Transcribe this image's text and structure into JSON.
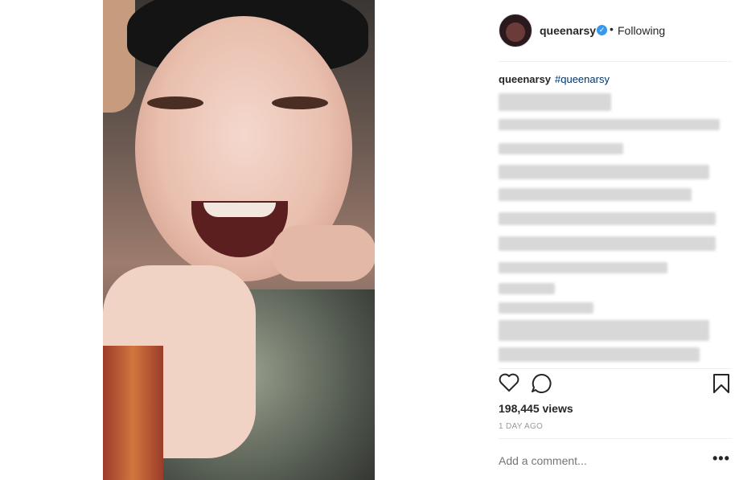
{
  "header": {
    "username": "queenarsy",
    "verified_icon": "verified-badge-icon",
    "separator": "•",
    "follow_status": "Following"
  },
  "caption": {
    "username": "queenarsy",
    "hashtag": "#queenarsy"
  },
  "stats": {
    "views": "198,445 views",
    "time_ago": "1 DAY AGO"
  },
  "comment": {
    "placeholder": "Add a comment..."
  },
  "more_label": "•••",
  "colors": {
    "accent": "#3897f0",
    "hashtag": "#003569",
    "muted": "#999999"
  },
  "icons": [
    "heart-icon",
    "comment-icon",
    "bookmark-icon",
    "more-options-icon"
  ]
}
